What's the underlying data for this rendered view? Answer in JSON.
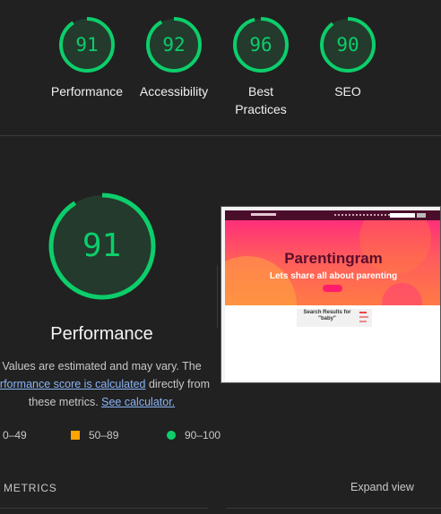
{
  "categories": [
    {
      "score": "91",
      "fraction": 0.91,
      "label": "Performance"
    },
    {
      "score": "92",
      "fraction": 0.92,
      "label": "Accessibility"
    },
    {
      "score": "96",
      "fraction": 0.96,
      "label": "Best\nPractices"
    },
    {
      "score": "90",
      "fraction": 0.9,
      "label": "SEO"
    }
  ],
  "performance": {
    "score": "91",
    "fraction": 0.91,
    "title": "Performance",
    "desc_line1": "Values are estimated and may vary. The",
    "desc_link1": "erformance score is calculated",
    "desc_mid": " directly from",
    "desc_line3_pre": "these metrics. ",
    "desc_link2": "See calculator."
  },
  "legend": {
    "fail": "0–49",
    "average": "50–89",
    "pass": "90–100"
  },
  "screenshot": {
    "heading": "Parentingram",
    "subheading": "Lets share all about parenting",
    "card_title": "Search Results for \"baby\""
  },
  "metrics": {
    "label": "METRICS",
    "expand": "Expand view"
  },
  "colors": {
    "pass": "#0cce6b",
    "average": "#ffa400",
    "fail": "#ff4e42",
    "background": "#212121"
  },
  "icons": {
    "fail": "triangle-icon",
    "average": "square-icon",
    "pass": "circle-icon"
  }
}
